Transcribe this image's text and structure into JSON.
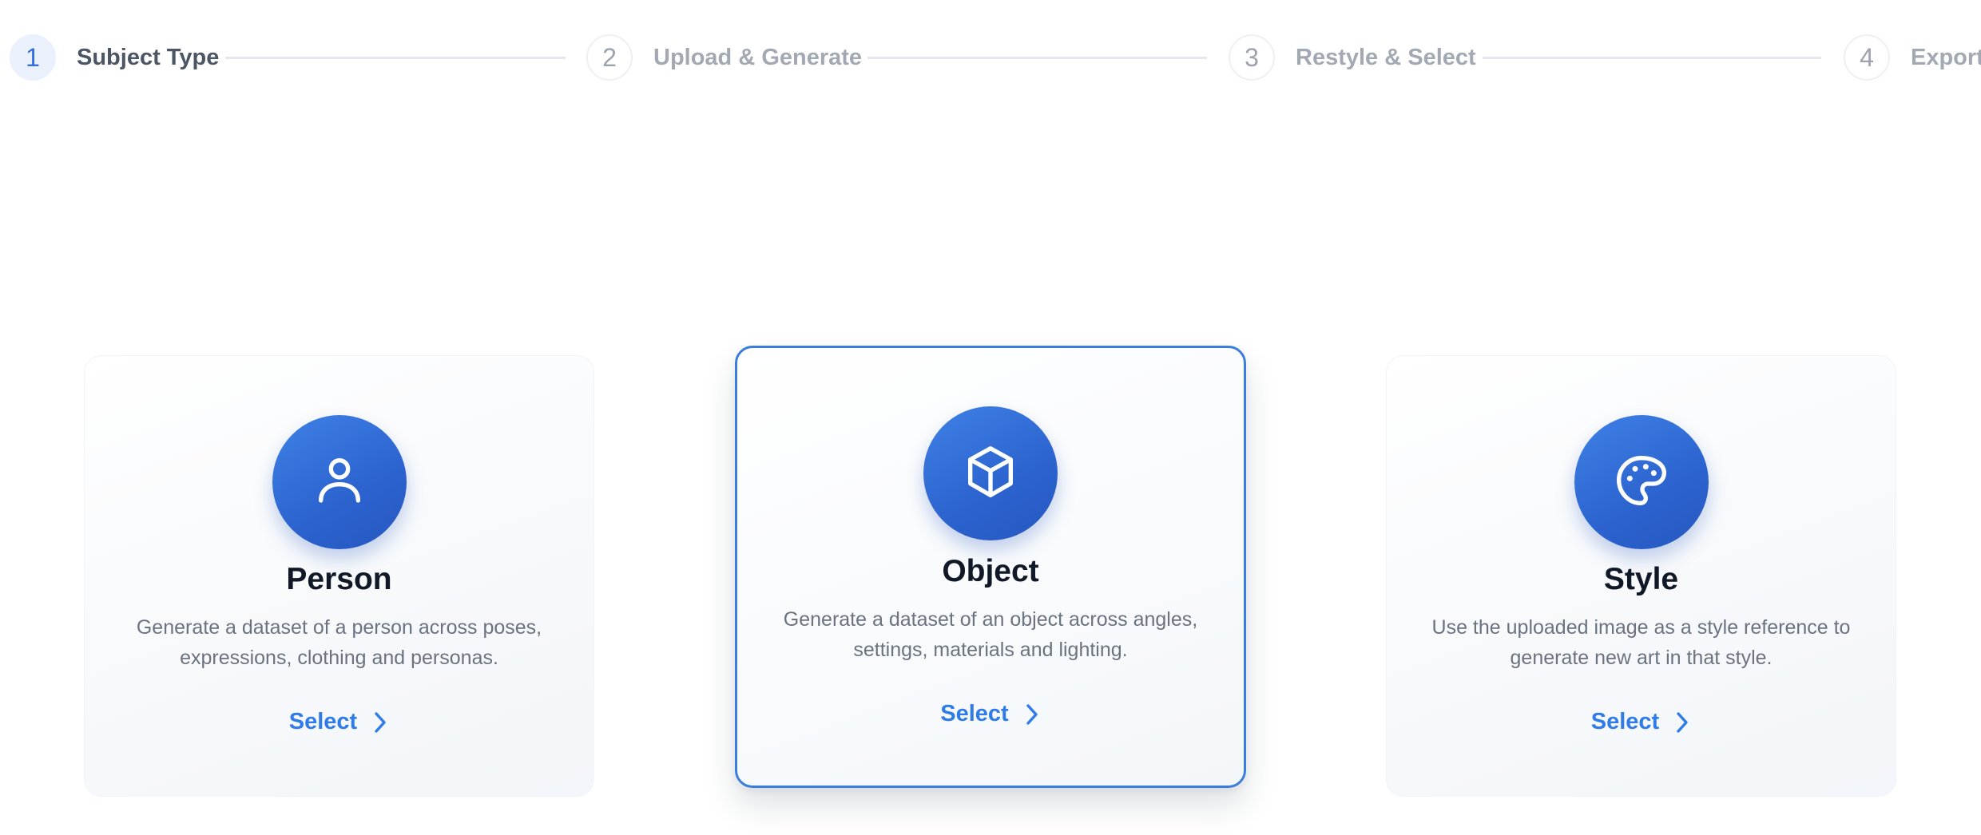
{
  "stepper": {
    "steps": [
      {
        "number": "1",
        "label": "Subject Type",
        "active": true
      },
      {
        "number": "2",
        "label": "Upload & Generate",
        "active": false
      },
      {
        "number": "3",
        "label": "Restyle & Select",
        "active": false
      },
      {
        "number": "4",
        "label": "Export",
        "active": false
      }
    ]
  },
  "cards": [
    {
      "title": "Person",
      "description_line1": "Generate a dataset of a person across poses,",
      "description_line2": "expressions, clothing and personas.",
      "select_label": "Select",
      "icon": "person-icon",
      "selected": false
    },
    {
      "title": "Object",
      "description_line1": "Generate a dataset of an object across angles,",
      "description_line2": "settings, materials and lighting.",
      "select_label": "Select",
      "icon": "cube-icon",
      "selected": true
    },
    {
      "title": "Style",
      "description_line1": "Use the uploaded image as a style reference to",
      "description_line2": "generate new art in that style.",
      "select_label": "Select",
      "icon": "palette-icon",
      "selected": false
    }
  ],
  "colors": {
    "accent": "#2f7be8",
    "icon_gradient_start": "#3f82e6",
    "icon_gradient_end": "#2657bf",
    "selected_border": "#3b7ddd"
  }
}
